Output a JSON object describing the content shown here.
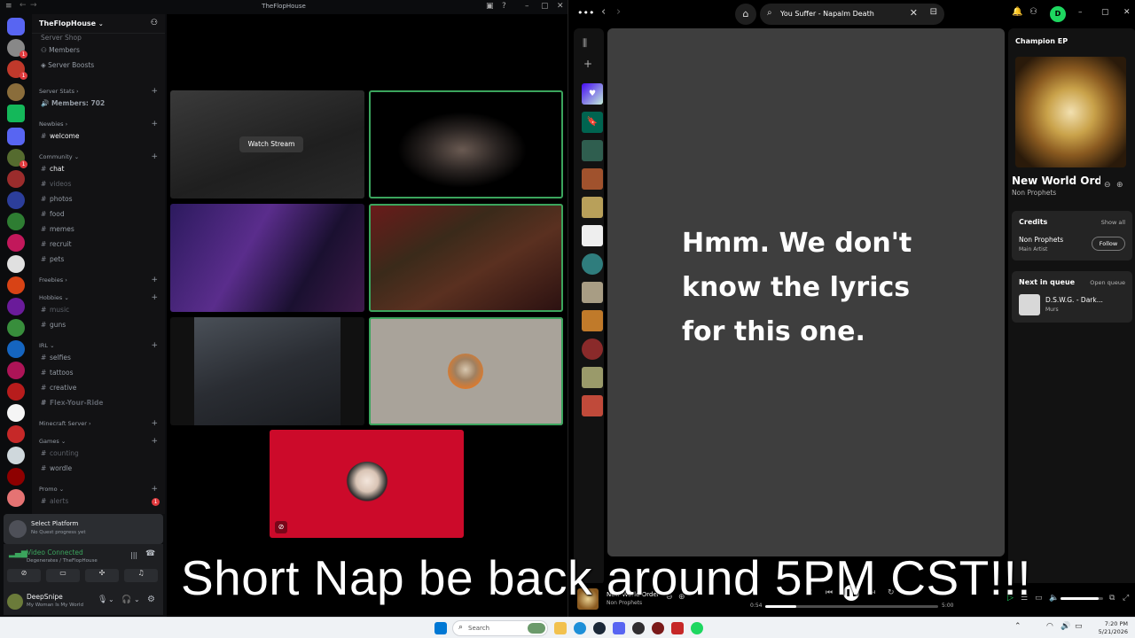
{
  "discord": {
    "window_title": "TheFlopHouse",
    "server_name": "TheFlopHouse",
    "nav": {
      "server_shop": "Server Shop",
      "members": "Members",
      "server_boosts": "Server Boosts"
    },
    "categories": {
      "server_stats": "Server Stats",
      "newbies": "Newbies",
      "community": "Community",
      "freebies": "Freebies",
      "hobbies": "Hobbies",
      "irl": "IRL",
      "minecraft": "Minecraft Server",
      "games": "Games",
      "promo": "Promo"
    },
    "channels": {
      "members_count": "Members: 702",
      "welcome": "welcome",
      "chat": "chat",
      "videos": "videos",
      "photos": "photos",
      "food": "food",
      "memes": "memes",
      "recruit": "recruit",
      "pets": "pets",
      "music": "music",
      "guns": "guns",
      "selfies": "selfies",
      "tattoos": "tattoos",
      "creative": "creative",
      "flex": "Flex-Your-Ride",
      "counting": "counting",
      "wordle": "wordle",
      "alerts": "alerts"
    },
    "alerts_badge": "1",
    "guild_badges": [
      "1",
      "1",
      "1"
    ],
    "quest": {
      "title": "Select Platform",
      "subtitle": "No Quest progress yet"
    },
    "voice": {
      "status": "Video Connected",
      "location": "Degenerates / TheFlopHouse"
    },
    "user": {
      "name": "DeepSnipe",
      "status": "My Woman Is My World"
    },
    "stage": {
      "watch_stream": "Watch Stream"
    }
  },
  "spotify": {
    "search_value": "You Suffer - Napalm Death",
    "lyrics_message": "Hmm. We don't know the lyrics for this one.",
    "avatar_letter": "D",
    "panel": {
      "album": "Champion EP",
      "track": "New World Order",
      "artist": "Non Prophets",
      "credits_heading": "Credits",
      "show_all": "Show all",
      "credit_name": "Non Prophets",
      "credit_role": "Main Artist",
      "follow": "Follow",
      "queue_heading": "Next in queue",
      "open_queue": "Open queue",
      "queue_track": "D.S.W.G. - Dark...",
      "queue_artist": "Murs"
    },
    "player": {
      "track": "New World Order",
      "artist": "Non Prophets",
      "elapsed": "0:54",
      "duration": "5:00",
      "progress": 0.18,
      "volume": 0.9
    }
  },
  "taskbar": {
    "search_placeholder": "Search",
    "time": "7:20 PM",
    "date": "5/21/2026"
  },
  "overlay_text": "Short Nap be back around 5PM CST!!!",
  "colors": {
    "discord_green": "#3ba55d",
    "spotify_green": "#1ed760",
    "badge_red": "#e03a3e"
  }
}
